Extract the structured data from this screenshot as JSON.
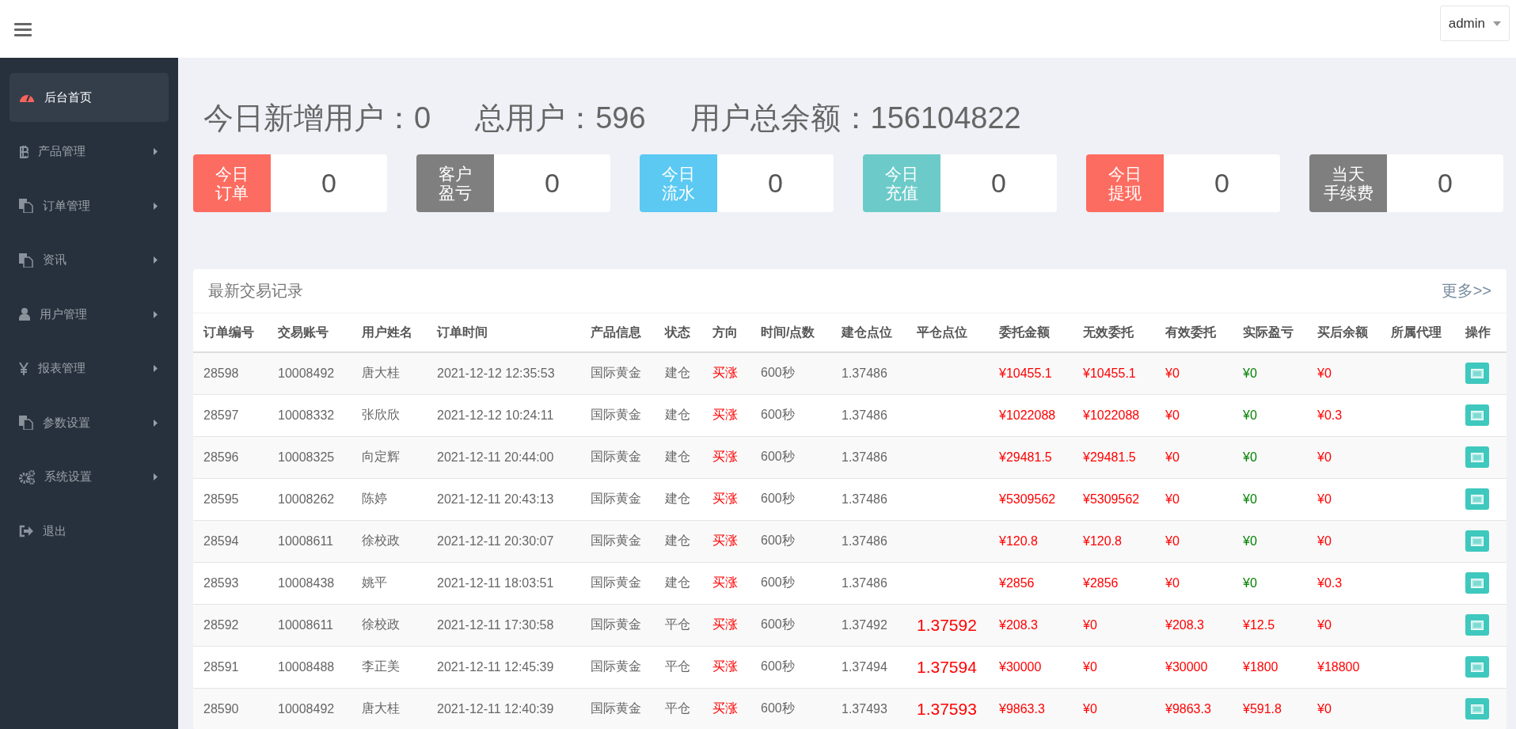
{
  "topbar": {
    "user_menu": "admin"
  },
  "sidebar": {
    "items": [
      {
        "label": "后台首页",
        "kind": "gauge",
        "selected": true,
        "expandable": false
      },
      {
        "label": "产品管理",
        "kind": "bitcoin",
        "selected": false,
        "expandable": true
      },
      {
        "label": "订单管理",
        "kind": "copy",
        "selected": false,
        "expandable": true
      },
      {
        "label": "资讯",
        "kind": "copy",
        "selected": false,
        "expandable": true
      },
      {
        "label": "用户管理",
        "kind": "user",
        "selected": false,
        "expandable": true
      },
      {
        "label": "报表管理",
        "kind": "yen",
        "selected": false,
        "expandable": true
      },
      {
        "label": "参数设置",
        "kind": "copy",
        "selected": false,
        "expandable": true
      },
      {
        "label": "系统设置",
        "kind": "gears",
        "selected": false,
        "expandable": true
      },
      {
        "label": "退出",
        "kind": "exit",
        "selected": false,
        "expandable": false
      }
    ]
  },
  "summary": [
    {
      "label": "今日新增用户：",
      "value": "0"
    },
    {
      "label": "总用户：",
      "value": "596"
    },
    {
      "label": "用户总余额：",
      "value": "156104822"
    }
  ],
  "stats": [
    {
      "label_lines": [
        "今日",
        "订单"
      ],
      "value": "0",
      "color": "#fd6c60"
    },
    {
      "label_lines": [
        "客户",
        "盈亏"
      ],
      "value": "0",
      "color": "#7f7f7f"
    },
    {
      "label_lines": [
        "今日",
        "流水"
      ],
      "value": "0",
      "color": "#5bc9f2"
    },
    {
      "label_lines": [
        "今日",
        "充值"
      ],
      "value": "0",
      "color": "#6ccbc9"
    },
    {
      "label_lines": [
        "今日",
        "提现"
      ],
      "value": "0",
      "color": "#fd6c60"
    },
    {
      "label_lines": [
        "当天",
        "手续费"
      ],
      "value": "0",
      "color": "#7f7f7f"
    }
  ],
  "trades": {
    "title": "最新交易记录",
    "more_link": "更多>>",
    "columns": [
      "订单编号",
      "交易账号",
      "用户姓名",
      "订单时间",
      "产品信息",
      "状态",
      "方向",
      "时间/点数",
      "建仓点位",
      "平仓点位",
      "委托金额",
      "无效委托",
      "有效委托",
      "实际盈亏",
      "买后余额",
      "所属代理",
      "操作"
    ],
    "rows": [
      {
        "order_no": "28598",
        "account": "10008492",
        "name": "唐大桂",
        "time": "2021-12-12 12:35:53",
        "product": "国际黄金",
        "status": "建仓",
        "direction": "买涨",
        "duration": "600秒",
        "open_price": "1.37486",
        "amount": "¥10455.1",
        "invalid": "¥10455.1",
        "valid": "¥0",
        "profit": "¥0",
        "color": "#008000",
        "balance": "¥0"
      },
      {
        "order_no": "28597",
        "account": "10008332",
        "name": "张欣欣",
        "time": "2021-12-12 10:24:11",
        "product": "国际黄金",
        "status": "建仓",
        "direction": "买涨",
        "duration": "600秒",
        "open_price": "1.37486",
        "amount": "¥1022088",
        "invalid": "¥1022088",
        "valid": "¥0",
        "profit": "¥0",
        "color": "#008000",
        "balance": "¥0.3"
      },
      {
        "order_no": "28596",
        "account": "10008325",
        "name": "向定辉",
        "time": "2021-12-11 20:44:00",
        "product": "国际黄金",
        "status": "建仓",
        "direction": "买涨",
        "duration": "600秒",
        "open_price": "1.37486",
        "amount": "¥29481.5",
        "invalid": "¥29481.5",
        "valid": "¥0",
        "profit": "¥0",
        "color": "#008000",
        "balance": "¥0"
      },
      {
        "order_no": "28595",
        "account": "10008262",
        "name": "陈婷",
        "time": "2021-12-11 20:43:13",
        "product": "国际黄金",
        "status": "建仓",
        "direction": "买涨",
        "duration": "600秒",
        "open_price": "1.37486",
        "amount": "¥5309562",
        "invalid": "¥5309562",
        "valid": "¥0",
        "profit": "¥0",
        "color": "#008000",
        "balance": "¥0"
      },
      {
        "order_no": "28594",
        "account": "10008611",
        "name": "徐校政",
        "time": "2021-12-11 20:30:07",
        "product": "国际黄金",
        "status": "建仓",
        "direction": "买涨",
        "duration": "600秒",
        "open_price": "1.37486",
        "amount": "¥120.8",
        "invalid": "¥120.8",
        "valid": "¥0",
        "profit": "¥0",
        "color": "#008000",
        "balance": "¥0"
      },
      {
        "order_no": "28593",
        "account": "10008438",
        "name": "姚平",
        "time": "2021-12-11 18:03:51",
        "product": "国际黄金",
        "status": "建仓",
        "direction": "买涨",
        "duration": "600秒",
        "open_price": "1.37486",
        "amount": "¥2856",
        "invalid": "¥2856",
        "valid": "¥0",
        "profit": "¥0",
        "color": "#008000",
        "balance": "¥0.3"
      },
      {
        "order_no": "28592",
        "account": "10008611",
        "name": "徐校政",
        "time": "2021-12-11 17:30:58",
        "product": "国际黄金",
        "status": "平仓",
        "direction": "买涨",
        "duration": "600秒",
        "open_price": "1.37492",
        "close_price": "1.37592",
        "amount": "¥208.3",
        "invalid": "¥0",
        "valid": "¥208.3",
        "profit": "¥12.5",
        "color": "#ff0000",
        "balance": "¥0"
      },
      {
        "order_no": "28591",
        "account": "10008488",
        "name": "李正美",
        "time": "2021-12-11 12:45:39",
        "product": "国际黄金",
        "status": "平仓",
        "direction": "买涨",
        "duration": "600秒",
        "open_price": "1.37494",
        "close_price": "1.37594",
        "amount": "¥30000",
        "invalid": "¥0",
        "valid": "¥30000",
        "profit": "¥1800",
        "color": "#ff0000",
        "balance": "¥18800"
      },
      {
        "order_no": "28590",
        "account": "10008492",
        "name": "唐大桂",
        "time": "2021-12-11 12:40:39",
        "product": "国际黄金",
        "status": "平仓",
        "direction": "买涨",
        "duration": "600秒",
        "open_price": "1.37493",
        "close_price": "1.37593",
        "amount": "¥9863.3",
        "invalid": "¥0",
        "valid": "¥9863.3",
        "profit": "¥591.8",
        "color": "#ff0000",
        "balance": "¥0"
      }
    ]
  }
}
